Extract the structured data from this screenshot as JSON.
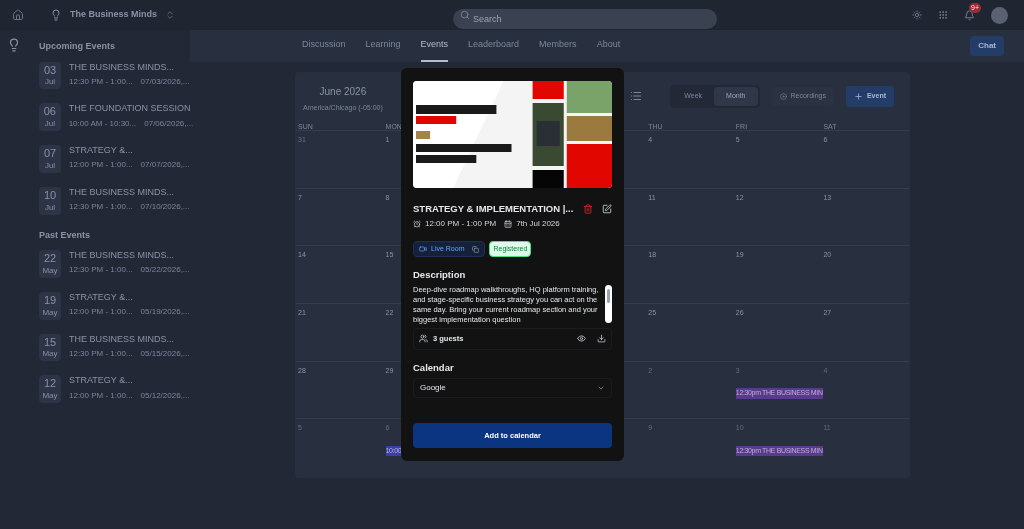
{
  "topbar": {
    "community": "The Business Minds",
    "search": {
      "placeholder": "Search"
    },
    "notifications": "9+"
  },
  "sidebar": {
    "upcoming_title": "Upcoming Events",
    "upcoming": [
      {
        "day": "03",
        "month": "Jul",
        "title": "THE BUSINESS MINDS...",
        "time": "12:30 PM - 1:00...",
        "date": "07/03/2026,..."
      },
      {
        "day": "06",
        "month": "Jul",
        "title": "THE FOUNDATION SESSION",
        "time": "10:00 AM - 10:30...",
        "date": "07/06/2026,..."
      },
      {
        "day": "07",
        "month": "Jul",
        "title": "STRATEGY &...",
        "time": "12:00 PM - 1:00...",
        "date": "07/07/2026,..."
      },
      {
        "day": "10",
        "month": "Jul",
        "title": "THE BUSINESS MINDS...",
        "time": "12:30 PM - 1:00...",
        "date": "07/10/2026,..."
      }
    ],
    "past_title": "Past Events",
    "past": [
      {
        "day": "22",
        "month": "May",
        "title": "THE BUSINESS MINDS...",
        "time": "12:30 PM - 1:00...",
        "date": "05/22/2026,..."
      },
      {
        "day": "19",
        "month": "May",
        "title": "STRATEGY &...",
        "time": "12:00 PM - 1:00...",
        "date": "05/19/2026,..."
      },
      {
        "day": "15",
        "month": "May",
        "title": "THE BUSINESS MINDS...",
        "time": "12:30 PM - 1:00...",
        "date": "05/15/2026,..."
      },
      {
        "day": "12",
        "month": "May",
        "title": "STRATEGY &...",
        "time": "12:00 PM - 1:00...",
        "date": "05/12/2026,..."
      }
    ]
  },
  "tabs": [
    {
      "label": "Discussion",
      "selected": false
    },
    {
      "label": "Learning",
      "selected": false
    },
    {
      "label": "Events",
      "selected": true
    },
    {
      "label": "Leaderboard",
      "selected": false
    },
    {
      "label": "Members",
      "selected": false
    },
    {
      "label": "About",
      "selected": false
    }
  ],
  "chat_button": "Chat",
  "calendar": {
    "month": "June 2026",
    "timezone": "America/Chicago (-05:00)",
    "views": [
      {
        "label": "Week",
        "selected": false
      },
      {
        "label": "Month",
        "selected": true
      }
    ],
    "recordings": "Recordings",
    "add_event": "Event",
    "left_columns": [
      {
        "weekday": "SUN",
        "days": [
          {
            "day": "31",
            "muted": true
          },
          {
            "day": "7",
            "muted": false
          },
          {
            "day": "14",
            "muted": false
          },
          {
            "day": "21",
            "muted": false
          },
          {
            "day": "28",
            "muted": false
          },
          {
            "day": "5",
            "muted": true
          }
        ]
      },
      {
        "weekday": "MON",
        "days": [
          {
            "day": "1",
            "muted": false
          },
          {
            "day": "8",
            "muted": false
          },
          {
            "day": "15",
            "muted": false
          },
          {
            "day": "22",
            "muted": false
          },
          {
            "day": "29",
            "muted": false
          },
          {
            "day": "6",
            "muted": true,
            "events": [
              {
                "label": "10:00",
                "color": "#3b3fa8"
              }
            ]
          }
        ]
      }
    ],
    "right_columns": [
      {
        "weekday": "THU",
        "days": [
          {
            "day": "4",
            "muted": false
          },
          {
            "day": "11",
            "muted": false
          },
          {
            "day": "18",
            "muted": false
          },
          {
            "day": "25",
            "muted": false
          },
          {
            "day": "2",
            "muted": true
          },
          {
            "day": "9",
            "muted": true
          }
        ]
      },
      {
        "weekday": "FRI",
        "days": [
          {
            "day": "5",
            "muted": false
          },
          {
            "day": "12",
            "muted": false
          },
          {
            "day": "19",
            "muted": false
          },
          {
            "day": "26",
            "muted": false
          },
          {
            "day": "3",
            "muted": true,
            "events": [
              {
                "label": "12:30pm THE BUSINESS MIN",
                "color": "#5b3a8c"
              }
            ]
          },
          {
            "day": "10",
            "muted": true,
            "events": [
              {
                "label": "12:30pm THE BUSINESS MIN",
                "color": "#5b3a8c"
              }
            ]
          }
        ]
      },
      {
        "weekday": "SAT",
        "days": [
          {
            "day": "6",
            "muted": false
          },
          {
            "day": "13",
            "muted": false
          },
          {
            "day": "20",
            "muted": false
          },
          {
            "day": "27",
            "muted": false
          },
          {
            "day": "4",
            "muted": true
          },
          {
            "day": "11",
            "muted": true
          }
        ]
      }
    ]
  },
  "modal": {
    "title": "STRATEGY & IMPLEMENTATION |...",
    "time": "12:00 PM - 1:00 PM",
    "date": "7th Jul 2026",
    "live_room": "Live Room",
    "status": "Registered",
    "description_title": "Description",
    "description": "Deep-dive roadmap walkthroughs, HQ platform training, and stage-specific business strategy you can act on the same day. Bring your current roadmap section and your biggest implementation question",
    "guests": "3 guests",
    "calendar_title": "Calendar",
    "calendar_value": "Google",
    "add_button": "Add to calendar"
  }
}
